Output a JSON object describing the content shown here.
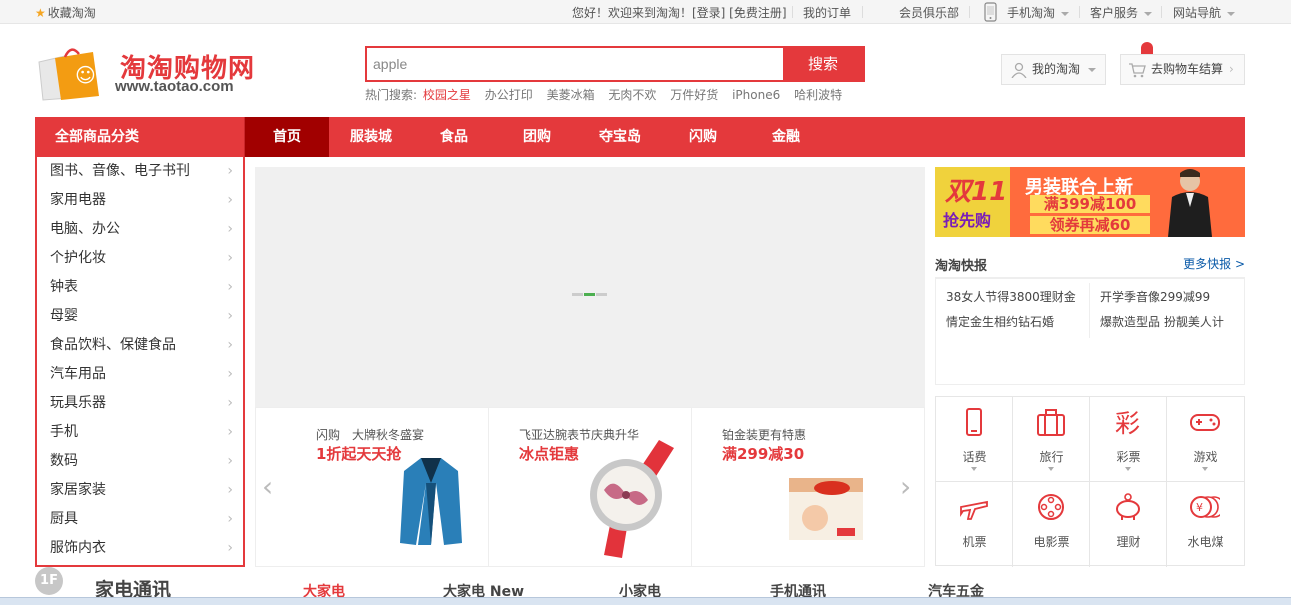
{
  "topbar": {
    "favorite": "收藏淘淘",
    "greeting": "您好！欢迎来到淘淘！[登录] [免费注册]",
    "orders": "我的订单",
    "club": "会员俱乐部",
    "mobile": "手机淘淘",
    "service": "客户服务",
    "sitenav": "网站导航"
  },
  "logo": {
    "title": "淘淘购物网",
    "url": "www.taotao.com"
  },
  "search": {
    "value": "apple",
    "button": "搜索",
    "hot_label": "热门搜索:",
    "hot_words": [
      "校园之星",
      "办公打印",
      "美菱冰箱",
      "无肉不欢",
      "万件好货",
      "iPhone6",
      "哈利波特"
    ]
  },
  "header": {
    "my": "我的淘淘",
    "cart": "去购物车结算"
  },
  "nav": {
    "all_categories": "全部商品分类",
    "items": [
      "首页",
      "服装城",
      "食品",
      "团购",
      "夺宝岛",
      "闪购",
      "金融"
    ]
  },
  "categories": [
    "图书、音像、电子书刊",
    "家用电器",
    "电脑、办公",
    "个护化妆",
    "钟表",
    "母婴",
    "食品饮料、保健食品",
    "汽车用品",
    "玩具乐器",
    "手机",
    "数码",
    "家居家装",
    "厨具",
    "服饰内衣"
  ],
  "promos": [
    {
      "sub": "闪购　大牌秋冬盛宴",
      "main": "1折起天天抢"
    },
    {
      "sub": "飞亚达腕表节庆典升华",
      "main": "冰点钜惠"
    },
    {
      "sub": "铂金装更有特惠",
      "main": "满299减30"
    }
  ],
  "ad": {
    "left_1": "双11",
    "left_2": "抢先购",
    "right_1": "男装联合上新",
    "right_2": "满399减100",
    "right_3": "领券再减60"
  },
  "news": {
    "title": "淘淘快报",
    "more": "更多快报 >",
    "items": [
      "38女人节得3800理财金",
      "开学季音像299减99",
      "情定金生相约钻石婚",
      "爆款造型品 扮靓美人计"
    ]
  },
  "services": [
    "话费",
    "旅行",
    "彩票",
    "游戏",
    "机票",
    "电影票",
    "理财",
    "水电煤"
  ],
  "floor": {
    "number": "1F",
    "title": "家电通讯",
    "tabs": [
      "大家电",
      "大家电 New",
      "小家电",
      "手机通讯",
      "汽车五金"
    ]
  },
  "colors": {
    "brand": "#e4393c",
    "nav_active": "#a10000"
  }
}
